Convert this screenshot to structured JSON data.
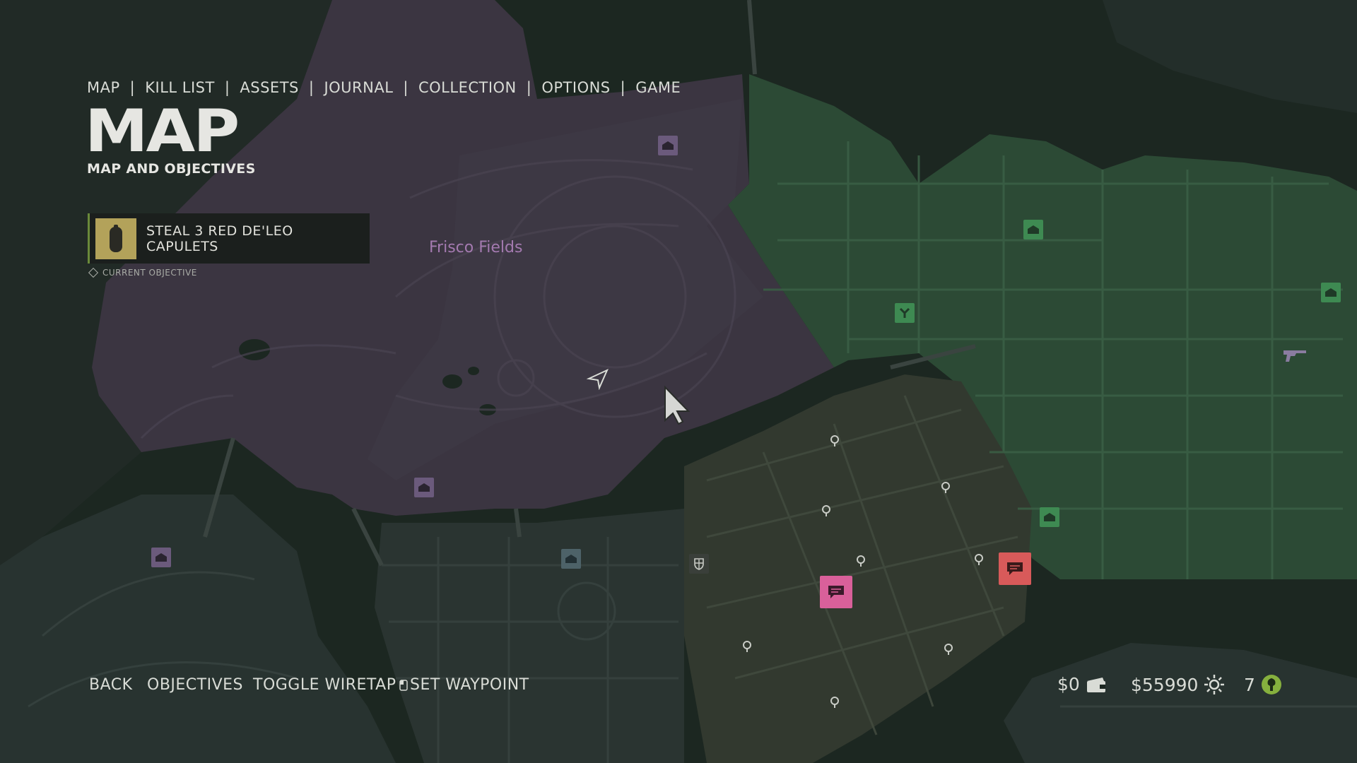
{
  "nav": {
    "items": [
      "MAP",
      "KILL LIST",
      "ASSETS",
      "JOURNAL",
      "COLLECTION",
      "OPTIONS",
      "GAME"
    ],
    "separator": "|"
  },
  "header": {
    "title": "MAP",
    "subtitle": "MAP AND OBJECTIVES"
  },
  "objective": {
    "text": "STEAL 3 RED DE'LEO CAPULETS",
    "label": "CURRENT OBJECTIVE",
    "icon": "lighter-icon"
  },
  "map": {
    "district_label": "Frisco Fields",
    "colors": {
      "water": "#1c2721",
      "land_dark": "#283330",
      "district_purple": "#3b3541",
      "district_green": "#2c4a35",
      "district_olive": "#32392f",
      "marker_purple": "#6b5a7c",
      "marker_green": "#3e8a52",
      "marker_pink": "#d9609a",
      "marker_red": "#d85a5a"
    }
  },
  "controls": {
    "back": "BACK",
    "objectives": "OBJECTIVES",
    "wiretap": "TOGGLE WIRETAP",
    "waypoint": "SET WAYPOINT"
  },
  "hud": {
    "cash": "$0",
    "bank": "$55990",
    "skill_points": "7"
  }
}
